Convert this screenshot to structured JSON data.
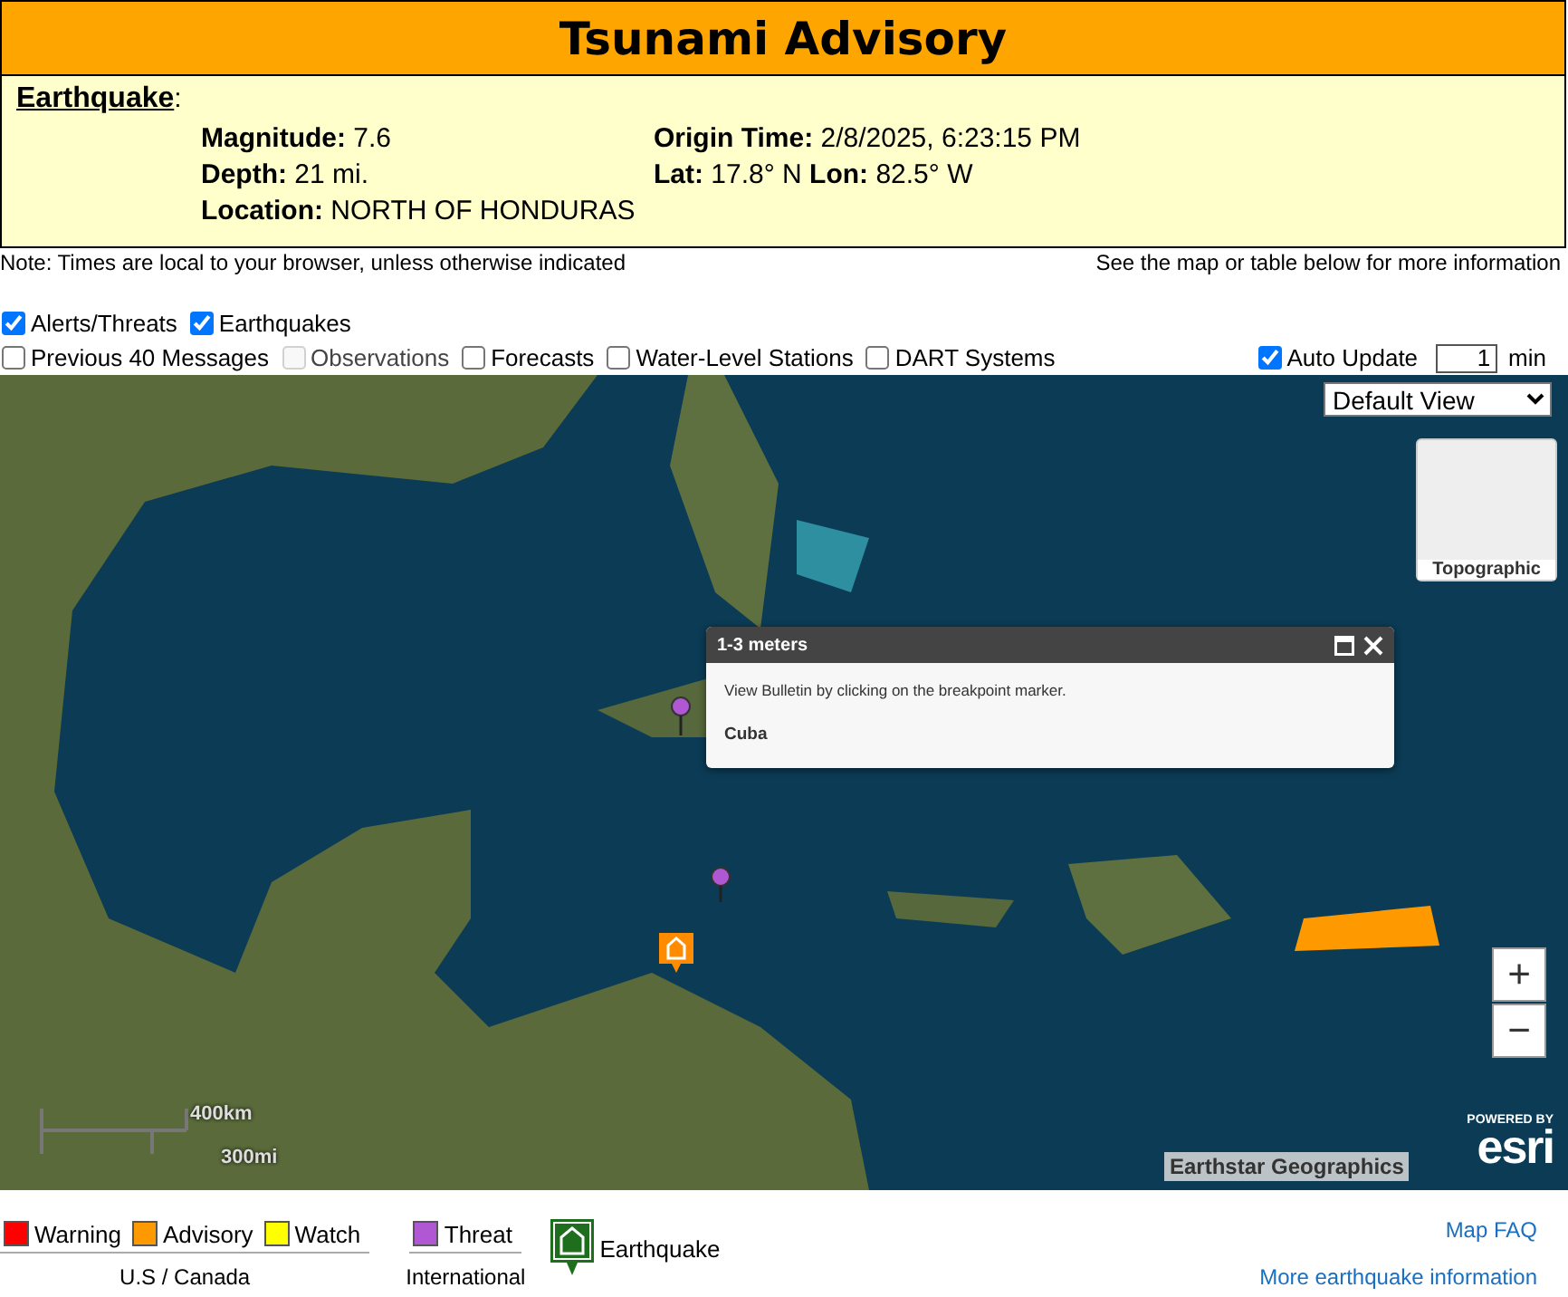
{
  "title": "Tsunami Advisory",
  "earthquake": {
    "heading": "Earthquake",
    "heading_suffix": ":",
    "fields": [
      {
        "label": "Magnitude:",
        "value": "7.6"
      },
      {
        "label": "Origin Time:",
        "value": "2/8/2025, 6:23:15 PM"
      },
      {
        "label": "Depth:",
        "value": "21 mi."
      },
      {
        "label": "Lat:",
        "value": "17.8° N",
        "label2": "Lon:",
        "value2": "82.5° W"
      },
      {
        "label": "Location:",
        "value": "NORTH OF HONDURAS"
      }
    ]
  },
  "note": "Note: Times are local to your browser, unless otherwise indicated",
  "note_right": "See the map or table below for more information",
  "layers_row1": [
    {
      "label": "Alerts/Threats",
      "checked": true,
      "disabled": false
    },
    {
      "label": "Earthquakes",
      "checked": true,
      "disabled": false
    }
  ],
  "layers_row2": [
    {
      "label": "Previous 40 Messages",
      "checked": false,
      "disabled": false
    },
    {
      "label": "Observations",
      "checked": false,
      "disabled": true
    },
    {
      "label": "Forecasts",
      "checked": false,
      "disabled": false
    },
    {
      "label": "Water-Level Stations",
      "checked": false,
      "disabled": false
    },
    {
      "label": "DART Systems",
      "checked": false,
      "disabled": false
    }
  ],
  "auto_update": {
    "label": "Auto Update",
    "checked": true,
    "value": "1",
    "unit": "min"
  },
  "map": {
    "view_select": "Default View",
    "basemap": "Topographic",
    "popup": {
      "title": "1-3 meters",
      "text": "View Bulletin by clicking on the breakpoint marker.",
      "place": "Cuba"
    },
    "zoom_in": "+",
    "zoom_out": "−",
    "scale_km": "400km",
    "scale_mi": "300mi",
    "attribution": "Earthstar Geographics",
    "powered_by": "POWERED BY",
    "logo": "esri"
  },
  "legend": {
    "us_canada": {
      "caption": "U.S / Canada",
      "items": [
        {
          "label": "Warning",
          "color": "#ff0000"
        },
        {
          "label": "Advisory",
          "color": "#ff9900"
        },
        {
          "label": "Watch",
          "color": "#ffff00"
        }
      ]
    },
    "international": {
      "caption": "International",
      "items": [
        {
          "label": "Threat",
          "color": "#b057d3"
        }
      ]
    },
    "earthquake": "Earthquake"
  },
  "links": [
    "Map FAQ",
    "More earthquake information"
  ]
}
